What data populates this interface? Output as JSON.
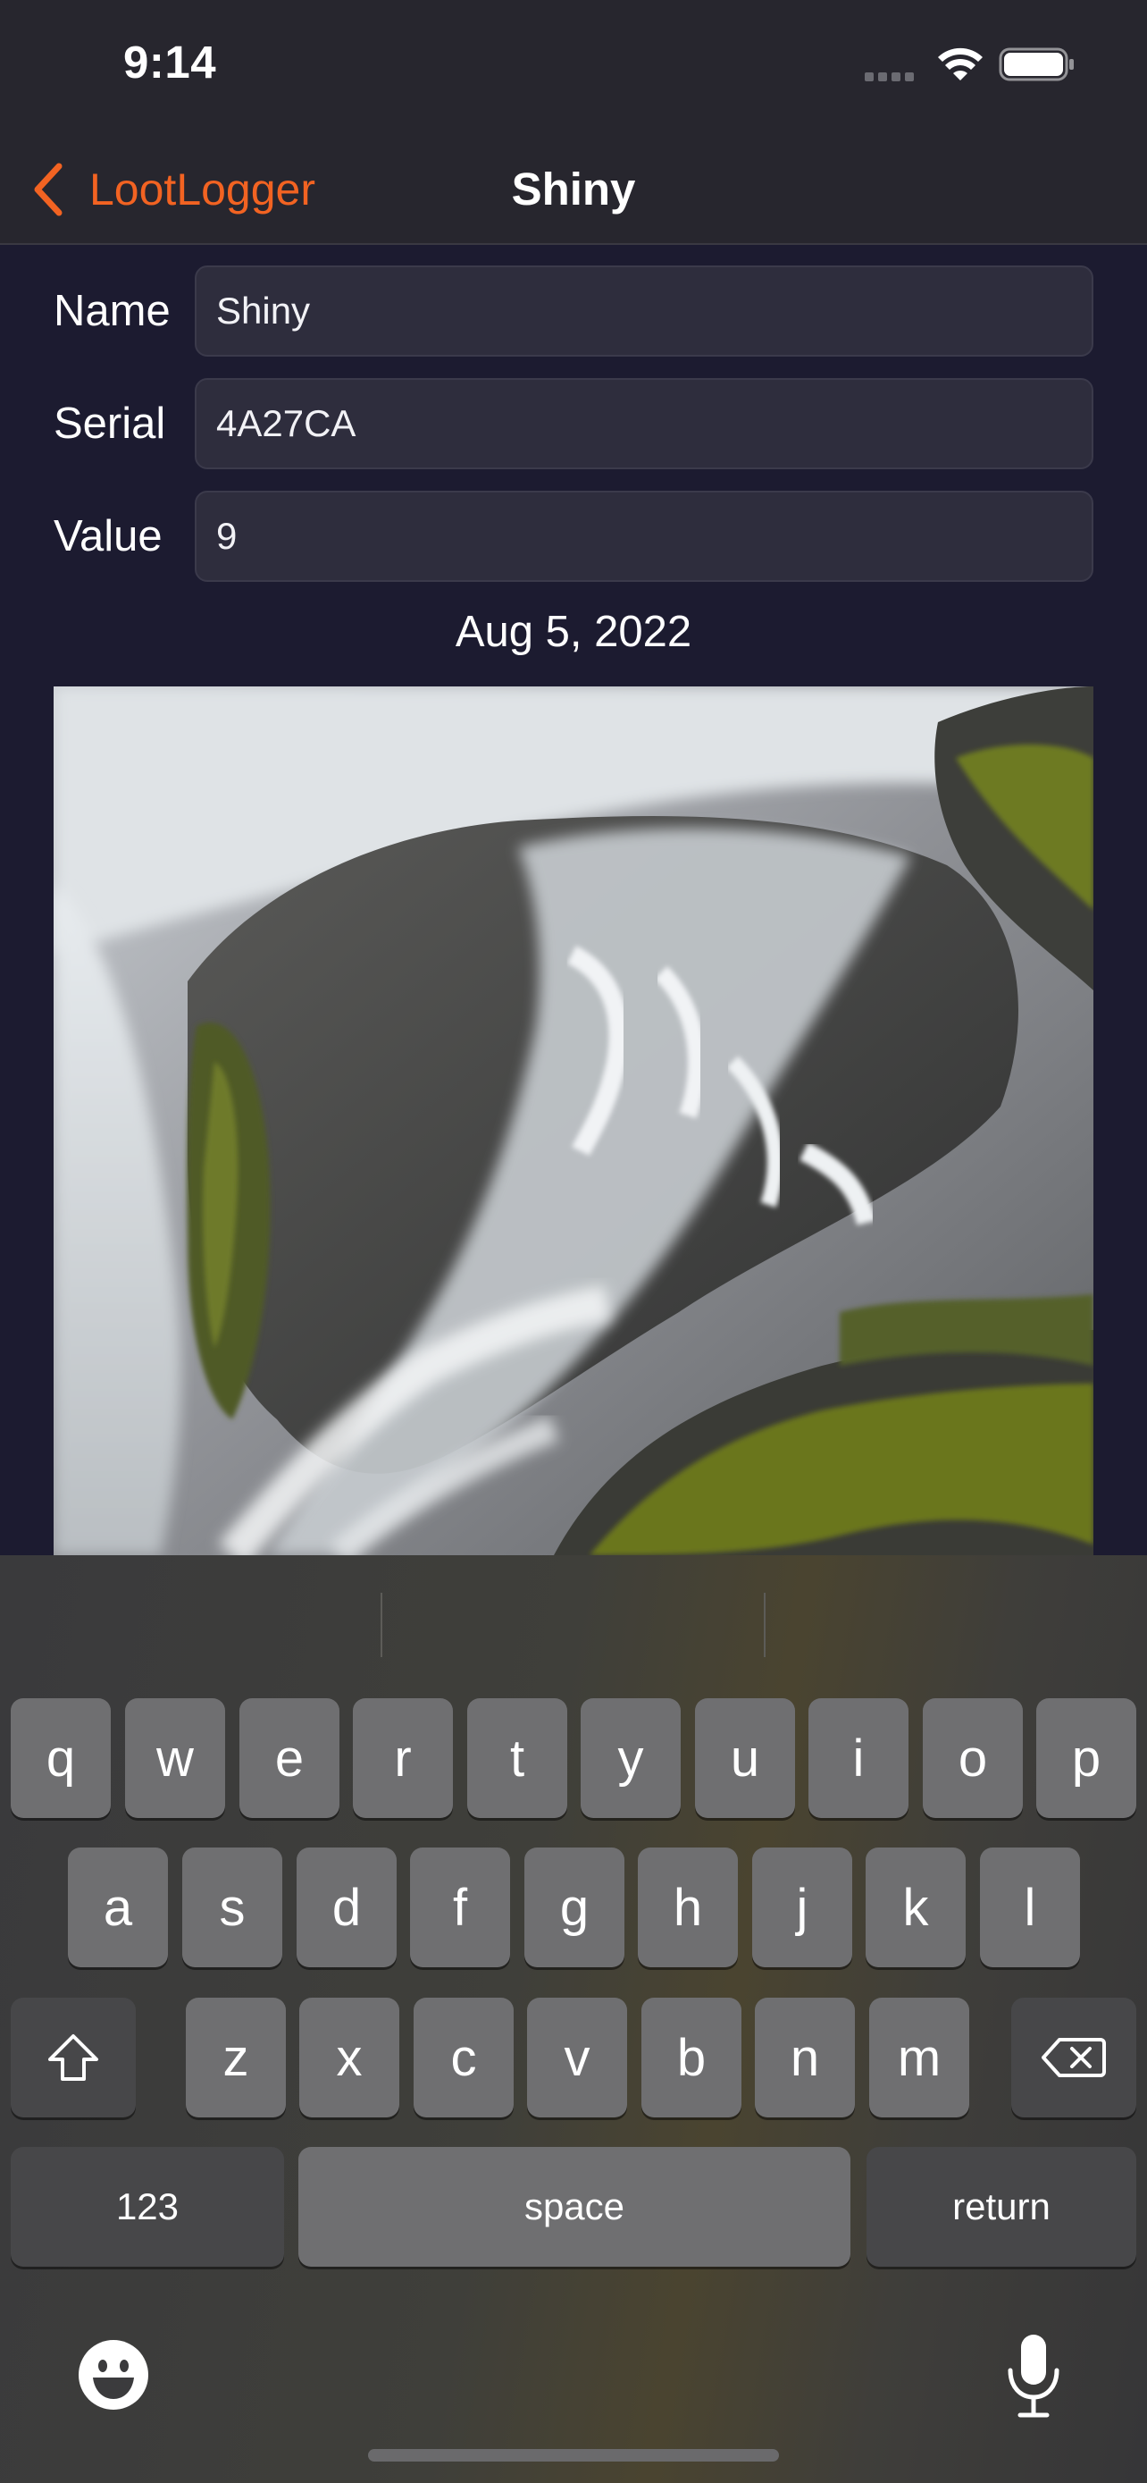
{
  "status_bar": {
    "time": "9:14",
    "icons": [
      "signal-icon",
      "wifi-icon",
      "battery-icon"
    ]
  },
  "nav": {
    "back_label": "LootLogger",
    "title": "Shiny",
    "accent_color": "#f26322"
  },
  "form": {
    "name_label": "Name",
    "name_value": "Shiny",
    "serial_label": "Serial",
    "serial_value": "4A27CA",
    "value_label": "Value",
    "value_value": "9",
    "date": "Aug 5, 2022"
  },
  "photo": {
    "subject": "waterfall over mossy rocks"
  },
  "keyboard": {
    "row1": [
      "q",
      "w",
      "e",
      "r",
      "t",
      "y",
      "u",
      "i",
      "o",
      "p"
    ],
    "row2": [
      "a",
      "s",
      "d",
      "f",
      "g",
      "h",
      "j",
      "k",
      "l"
    ],
    "row3": [
      "z",
      "x",
      "c",
      "v",
      "b",
      "n",
      "m"
    ],
    "numbers_label": "123",
    "space_label": "space",
    "return_label": "return",
    "icons": [
      "shift-icon",
      "delete-icon",
      "emoji-icon",
      "microphone-icon"
    ]
  }
}
